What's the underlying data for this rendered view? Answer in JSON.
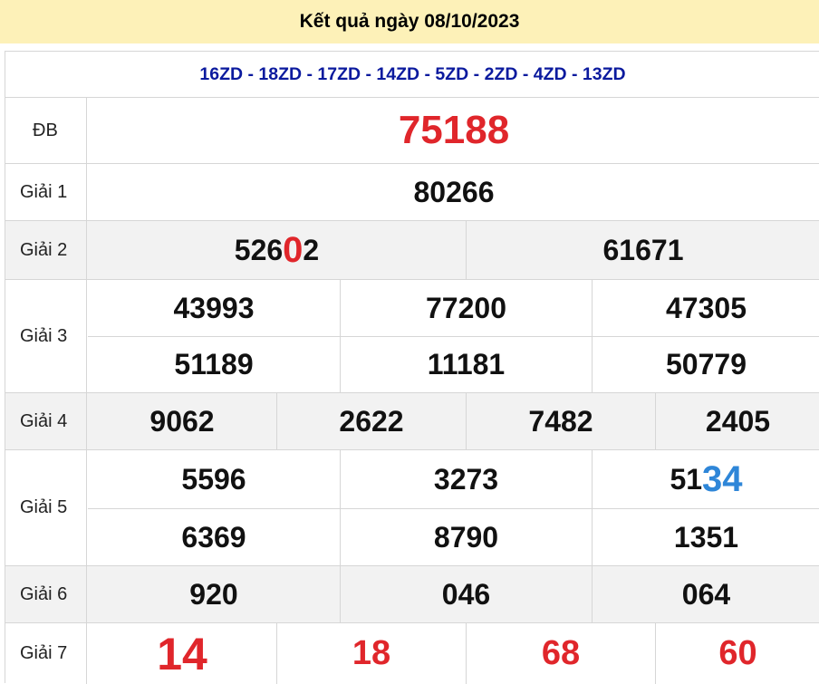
{
  "header": {
    "title": "Kết quả ngày 08/10/2023"
  },
  "codes": "16ZD - 18ZD - 17ZD - 14ZD - 5ZD - 2ZD - 4ZD - 13ZD",
  "prizes": {
    "db": {
      "label": "ĐB",
      "numbers": [
        "75188"
      ]
    },
    "giai1": {
      "label": "Giải 1",
      "numbers": [
        "80266"
      ]
    },
    "giai2": {
      "label": "Giải 2",
      "numbers": [
        {
          "prefix": "526",
          "highlight": "0",
          "suffix": "2"
        },
        "61671"
      ]
    },
    "giai3": {
      "label": "Giải 3",
      "numbers": [
        "43993",
        "77200",
        "47305",
        "51189",
        "11181",
        "50779"
      ]
    },
    "giai4": {
      "label": "Giải 4",
      "numbers": [
        "9062",
        "2622",
        "7482",
        "2405"
      ]
    },
    "giai5": {
      "label": "Giải 5",
      "numbers": [
        "5596",
        "3273",
        {
          "prefix": "51",
          "highlight": "34"
        },
        "6369",
        "8790",
        "1351"
      ]
    },
    "giai6": {
      "label": "Giải 6",
      "numbers": [
        "920",
        "046",
        "064"
      ]
    },
    "giai7": {
      "label": "Giải 7",
      "numbers": [
        "14",
        "18",
        "68",
        "60"
      ]
    }
  },
  "colors": {
    "highlight_red": "#e0262b",
    "highlight_blue": "#2e86d8",
    "codes_blue": "#0b1a9e",
    "header_bg": "#fdf1b8"
  }
}
